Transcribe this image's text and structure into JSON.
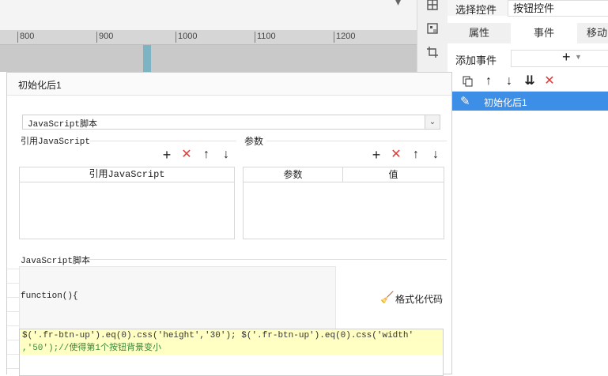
{
  "ruler": {
    "labels": [
      "800",
      "900",
      "1000",
      "1100",
      "1200"
    ]
  },
  "right_panel": {
    "select_control_label": "选择控件",
    "selected_control": "按钮控件",
    "tabs": [
      "属性",
      "事件",
      "移动"
    ],
    "add_event_label": "添加事件",
    "add_event_symbol": "+",
    "events": [
      "初始化后1"
    ]
  },
  "dialog": {
    "title": "初始化后1",
    "script_type": "JavaScript脚本",
    "ref_js_section": "引用JavaScript",
    "ref_js_column": "引用JavaScript",
    "params_section": "参数",
    "params_columns": [
      "参数",
      "值"
    ],
    "script_section": "JavaScript脚本",
    "function_header": "function(){",
    "format_code_label": "格式化代码",
    "code_line1": "$('.fr-btn-up').eq(0).css('height','30'); $('.fr-btn-up').eq(0).css('width'",
    "code_line2": ",'50');//使得第1个按钮背景变小"
  },
  "colors": {
    "selected_row": "#3d8ee6",
    "delete_red": "#e03a3a",
    "code_highlight": "#ffffb3"
  },
  "icons": [
    "add-icon",
    "delete-icon",
    "move-up-icon",
    "move-down-icon",
    "copy-icon",
    "move-bottom-icon",
    "edit-icon",
    "broom-icon",
    "chevron-down-icon"
  ]
}
